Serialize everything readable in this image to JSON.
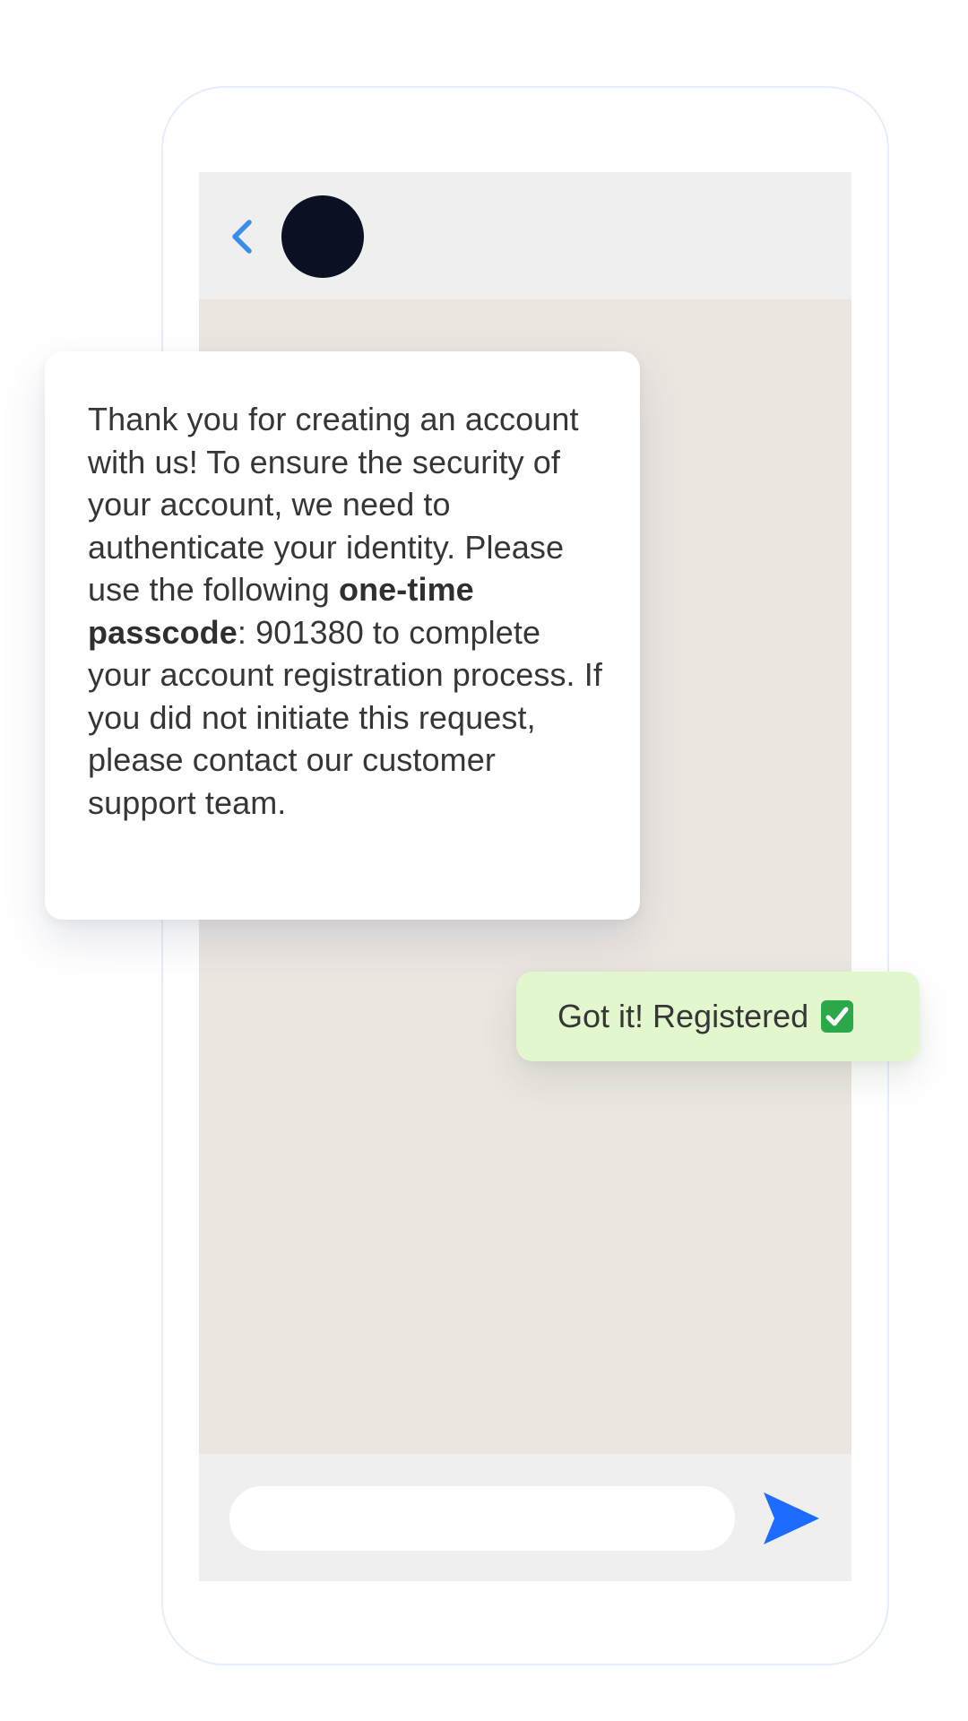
{
  "chat": {
    "header": {
      "back_icon": "chevron-left-icon",
      "avatar_color": "#0b1022"
    },
    "messages": {
      "incoming": {
        "text_before": "Thank you for creating an account with us! To ensure the security of your account, we need to authenticate your identity. Please use the following ",
        "text_bold": "one-time passcode",
        "text_after": ": 901380 to complete your account registration process. If you did not initiate this request, please contact our customer support team."
      },
      "outgoing": {
        "text": "Got it! Registered",
        "status_icon": "check-box-icon"
      }
    },
    "composer": {
      "input_value": "",
      "send_icon": "send-icon"
    }
  },
  "colors": {
    "accent_blue": "#1e6bff",
    "back_chevron": "#3a8ee8",
    "chat_background": "#ebe6e0",
    "header_background": "#efefef",
    "outgoing_bubble": "#e2f7cd",
    "check_green": "#2aa84a"
  }
}
